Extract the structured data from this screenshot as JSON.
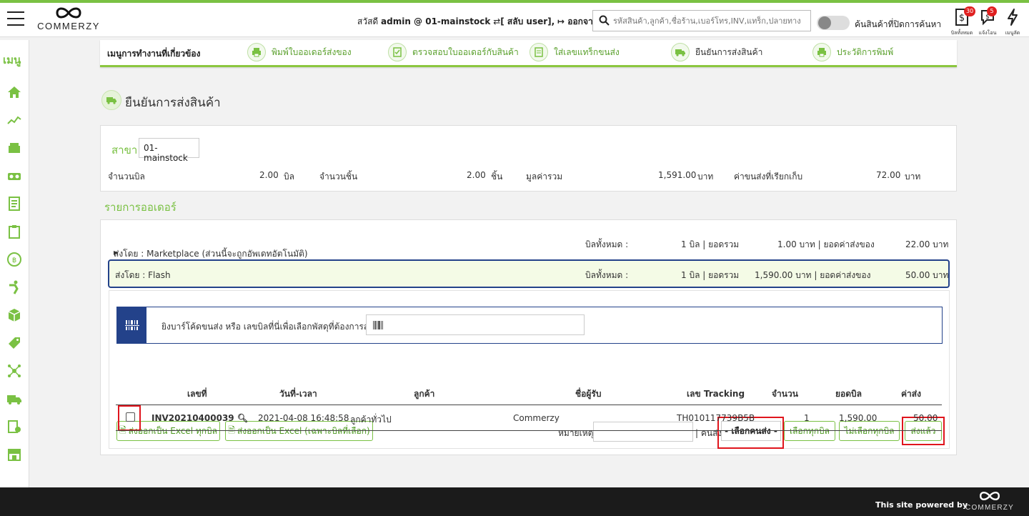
{
  "header": {
    "logo_text": "COMMERZY",
    "greeting_prefix": "สวัสดี",
    "user": "admin @ 01-mainstock",
    "switch_user": "[ สลับ user],",
    "logout": "ออกจากระบบ",
    "search_placeholder": "รหัสสินค้า,ลูกค้า,ชื่อร้าน,เบอร์โทร,INV,แทร็ก,ปลายทาง",
    "toggle_label": "ค้นสินค้าที่ปิดการค้นหา",
    "icons": [
      {
        "label": "บิลทั้งหมด",
        "badge": "30",
        "icon": "bill-dollar-icon"
      },
      {
        "label": "แจ้งโอน",
        "badge": "5",
        "icon": "chat-bubble-icon"
      },
      {
        "label": "เมนูลัด",
        "badge": "",
        "icon": "lightning-icon"
      }
    ]
  },
  "sidebar": {
    "label": "เมนู",
    "icons": [
      "home-icon",
      "chart-icon",
      "register-icon",
      "truck-icon",
      "document-icon",
      "clipboard-icon",
      "coin-icon",
      "stretch-icon",
      "box-icon",
      "tag-icon",
      "network-icon",
      "delivery-icon",
      "report-icon",
      "store-icon"
    ]
  },
  "subnav": {
    "title": "เมนูการทำงานที่เกี่ยวข้อง",
    "items": [
      "พิมพ์ใบออเดอร์ส่งของ",
      "ตรวจสอบใบออเดอร์กับสินค้า",
      "ใส่เลขแทร็กขนส่ง",
      "ยืนยันการส่งสินค้า",
      "ประวัติการพิมพ์"
    ]
  },
  "page": {
    "title": "ยืนยันการส่งสินค้า"
  },
  "summary": {
    "branch_label": "สาขา",
    "branch_value": "01-mainstock",
    "bill_count_label": "จำนวนบิล",
    "bill_count": "2.00",
    "bill_unit": "บิล",
    "piece_count_label": "จำนวนชิ้น",
    "piece_count": "2.00",
    "piece_unit": "ชิ้น",
    "total_value_label": "มูลค่ารวม",
    "total_value": "1,591.00",
    "total_unit": "บาท",
    "shipping_fee_label": "ค่าขนส่งที่เรียกเก็บ",
    "shipping_fee": "72.00",
    "shipping_unit": "บาท"
  },
  "orders": {
    "section_title": "รายการออเดอร์",
    "groups": [
      {
        "name": "ส่งโดย : Marketplace (ส่วนนี้จะถูกอัพเดทอัตโนมัติ)",
        "bills_label": "บิลทั้งหมด :",
        "bills": "1 บิล | ยอดรวม",
        "total": "1.00 บาท | ยอดค่าส่งของ",
        "shipping": "22.00 บาท"
      },
      {
        "name": "ส่งโดย : Flash",
        "bills_label": "บิลทั้งหมด :",
        "bills": "1 บิล | ยอดรวม",
        "total": "1,590.00 บาท | ยอดค่าส่งของ",
        "shipping": "50.00 บาท"
      }
    ],
    "barcode_label": "ยิงบาร์โค้ดขนส่ง หรือ เลขบิลที่นี่เพื่อเลือกพัสดุที่ต้องการส่ง",
    "export_all": "ส่งออกเป็น Excel ทุกบิล",
    "export_selected": "ส่งออกเป็น Excel (เฉพาะบิลที่เลือก)",
    "note_label": "หมายเหตุ",
    "courier_label": "| คนส่ง",
    "courier_select": "- เลือกคนส่ง -",
    "select_all": "เลือกทุกบิล",
    "deselect_all": "ไม่เลือกทุกบิล",
    "shipped": "ส่งแล้ว",
    "columns": [
      "เลขที่",
      "วันที่-เวลา",
      "ลูกค้า",
      "ชื่อผู้รับ",
      "เลข Tracking",
      "จำนวน",
      "ยอดบิล",
      "ค่าส่ง"
    ],
    "rows": [
      {
        "invoice": "INV20210400039",
        "datetime": "2021-04-08 16:48:58",
        "customer": "ลูกค้าทั่วไป",
        "recipient": "Commerzy",
        "tracking": "TH010117739B5B",
        "qty": "1",
        "amount": "1,590.00",
        "shipping": "50.00"
      }
    ]
  },
  "footer": {
    "powered_by": "This site powered by",
    "logo_text": "COMMERZY"
  }
}
